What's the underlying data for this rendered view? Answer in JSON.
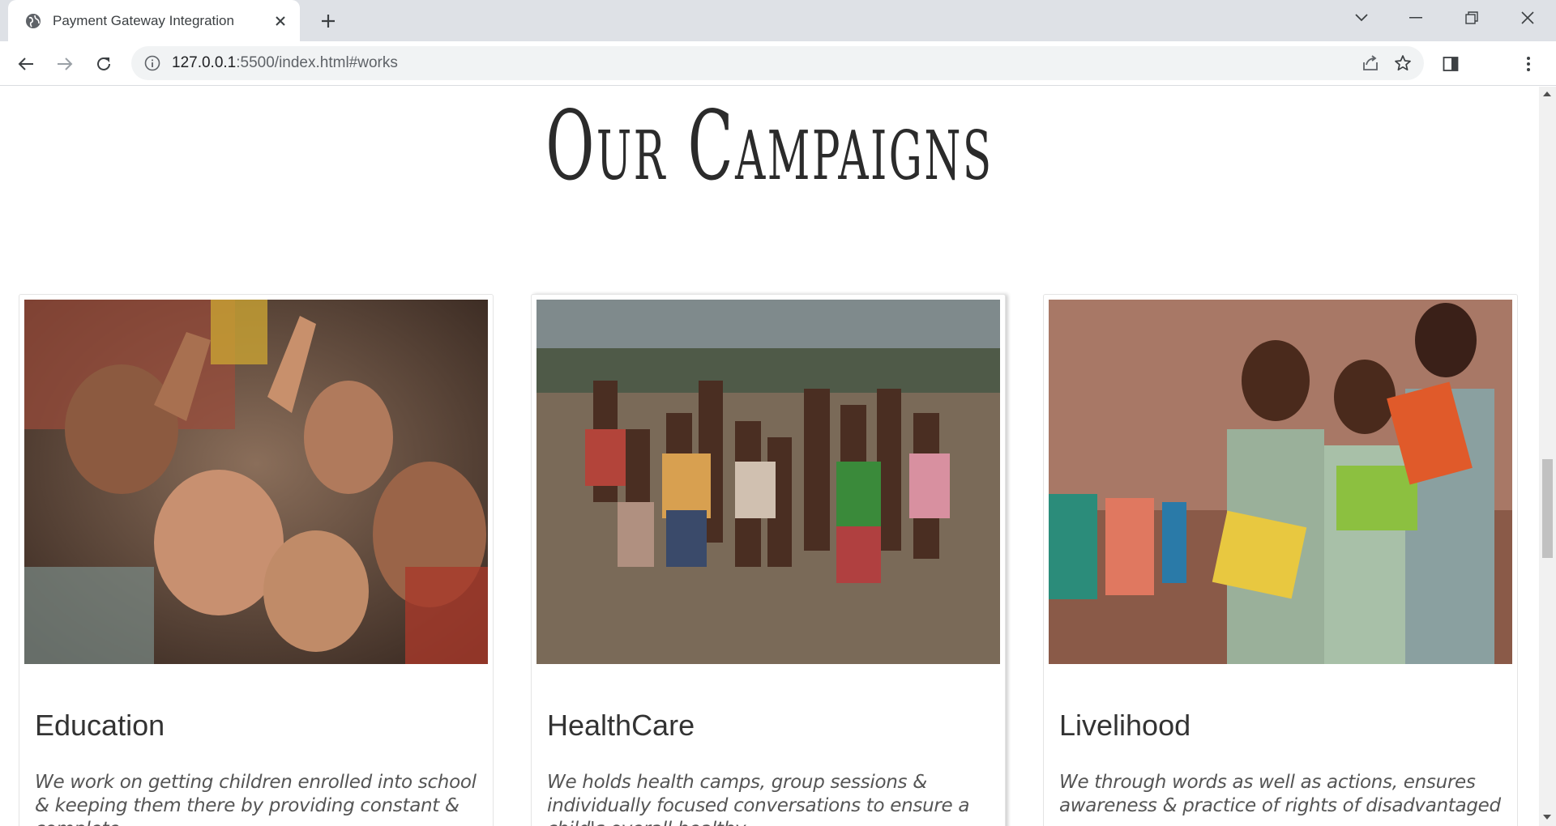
{
  "browser": {
    "tab_title": "Payment Gateway Integration",
    "url_host": "127.0.0.1",
    "url_rest": ":5500/index.html#works"
  },
  "page": {
    "heading": "Our Campaigns",
    "cards": [
      {
        "title": "Education",
        "text": "We work on getting children enrolled into school & keeping them there by providing constant & complete",
        "image_alt": "group of smiling children making peace signs"
      },
      {
        "title": "HealthCare",
        "text": "We holds health camps, group sessions & individually focused conversations to ensure a child's overall healthy",
        "image_alt": "group of children standing in a field"
      },
      {
        "title": "Livelihood",
        "text": "We through words as well as actions, ensures awareness & practice of rights of disadvantaged",
        "image_alt": "three children holding books in front of a wall"
      }
    ]
  },
  "colors": {
    "chrome_bg": "#dee1e6",
    "omnibox_bg": "#f1f3f4",
    "heading": "#2b2b2b",
    "card_border": "#e4e4e4"
  }
}
